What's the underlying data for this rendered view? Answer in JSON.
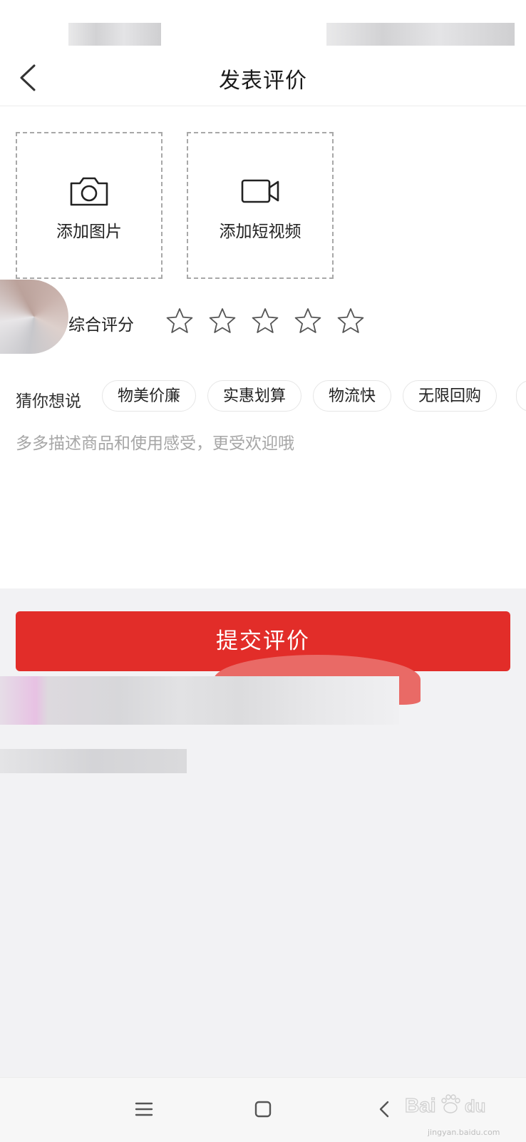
{
  "header": {
    "title": "发表评价",
    "back_icon": "chevron-left-icon"
  },
  "upload": {
    "photo_label": "添加图片",
    "photo_icon": "camera-icon",
    "video_label": "添加短视频",
    "video_icon": "video-camera-icon"
  },
  "rating": {
    "label": "综合评分",
    "max_stars": 5,
    "selected_stars": 0
  },
  "suggestions": {
    "label": "猜你想说",
    "tags": [
      "物美价廉",
      "实惠划算",
      "物流快",
      "无限回购"
    ]
  },
  "review": {
    "placeholder": "多多描述商品和使用感受，更受欢迎哦",
    "value": ""
  },
  "submit": {
    "label": "提交评价",
    "color": "#e22d29"
  },
  "nav": {
    "menu_icon": "menu-icon",
    "home_icon": "square-home-icon",
    "back_icon": "triangle-back-icon"
  },
  "watermark": {
    "url": "jingyan.baidu.com"
  }
}
